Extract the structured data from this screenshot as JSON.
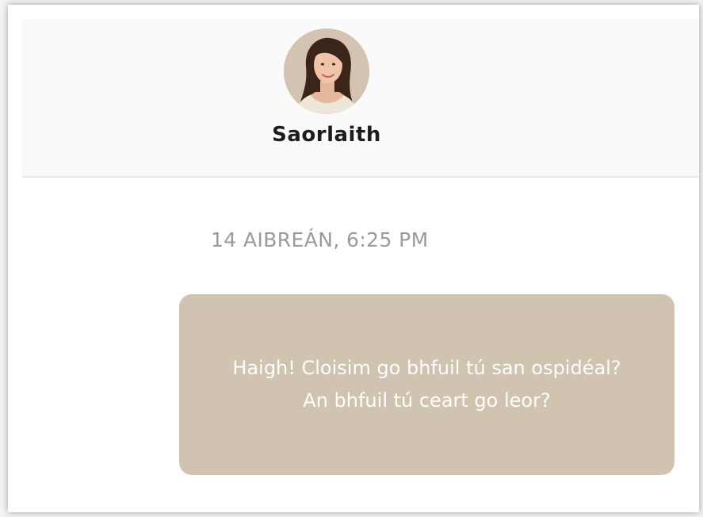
{
  "contact": {
    "name": "Saorlaith",
    "avatar_icon": "avatar-photo"
  },
  "conversation": {
    "timestamp": "14 AIBREÁN, 6:25 PM",
    "messages": [
      {
        "direction": "outgoing",
        "text": "Haigh! Cloisim go bhfuil tú san ospidéal?\nAn bhfuil tú ceart go leor?"
      }
    ]
  },
  "colors": {
    "bubble": "#d0c4b0",
    "bubble_text": "#ffffff",
    "timestamp": "#9a9a9a",
    "name": "#1c1c1c"
  }
}
